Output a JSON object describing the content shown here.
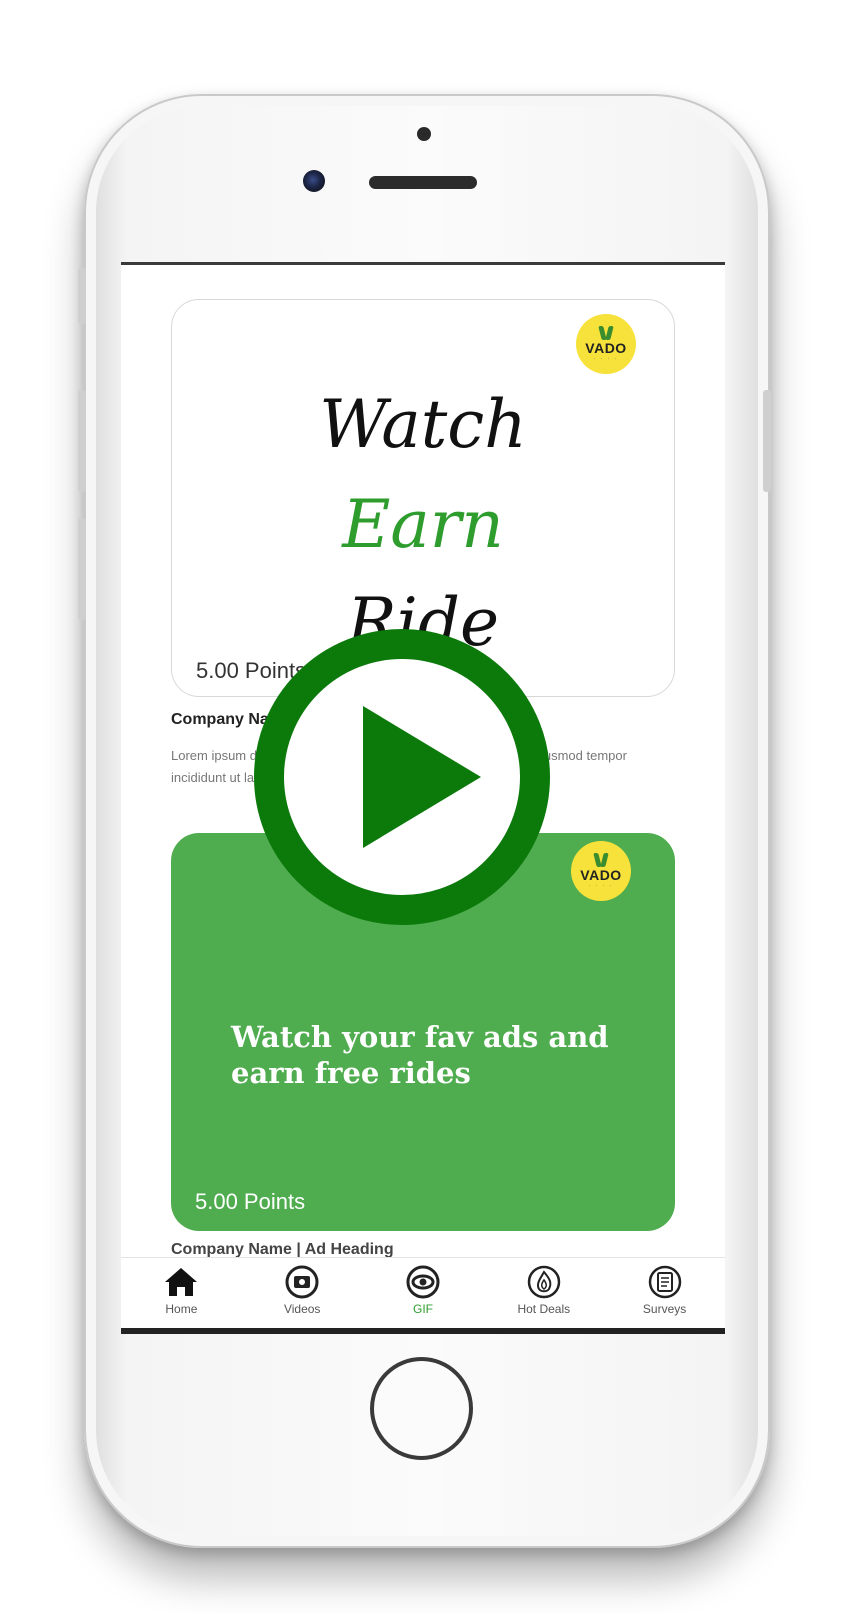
{
  "card1": {
    "badge_text": "VADO",
    "script_line1": "Watch",
    "script_line2": "Earn",
    "script_line3": "Ride",
    "points": "5.00 Points",
    "company": "Company Name | Ad Heading",
    "description": "Lorem ipsum dolor sit amet, consectetur adipiscing elit, sed do eiusmod tempor incididunt ut labore et dolore"
  },
  "card2": {
    "badge_text": "VADO",
    "ad_text": "Watch your fav ads and earn free rides",
    "points": "5.00 Points",
    "company": "Company Name | Ad Heading"
  },
  "nav": [
    {
      "label": "Home",
      "icon": "home-icon"
    },
    {
      "label": "Videos",
      "icon": "video-icon"
    },
    {
      "label": "GIF",
      "icon": "gif-icon"
    },
    {
      "label": "Hot Deals",
      "icon": "hot-deals-icon"
    },
    {
      "label": "Surveys",
      "icon": "survey-icon"
    }
  ],
  "colors": {
    "accent": "#2e9d2e",
    "card_green": "#4fac4f",
    "play_green": "#0b7a0b",
    "badge_yellow": "#f6e23a"
  }
}
